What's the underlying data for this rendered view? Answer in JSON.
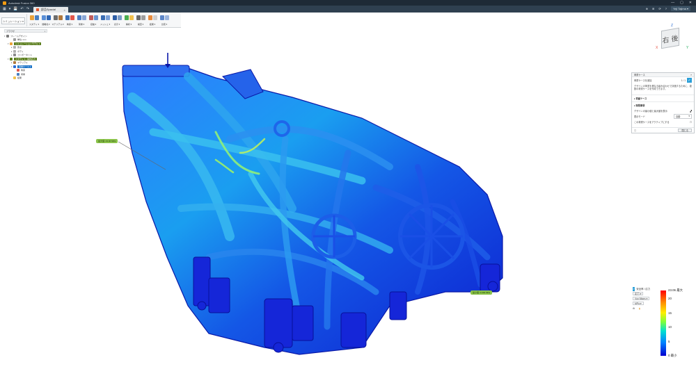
{
  "window": {
    "title": "Autodesk Fusion 360",
    "controls": [
      "—",
      "▢",
      "✕"
    ]
  },
  "tab": {
    "label": "部品Spacial",
    "close": "×"
  },
  "quick_access": [
    "▦",
    "▾",
    "💾",
    "↶",
    "↷"
  ],
  "top_right": {
    "user": "Yeji Tajima ▾",
    "icons": [
      "⊕",
      "⊞",
      "⟳",
      "?"
    ]
  },
  "ribbon": {
    "workspace": "シミュレーション ▾",
    "groups": [
      {
        "label": "スタディ ▾",
        "colors": [
          "#e9a23b",
          "#4a7fc1"
        ]
      },
      {
        "label": "簡略化 ▾",
        "colors": [
          "#5a8fd6",
          "#2d66b5"
        ]
      },
      {
        "label": "マテリアル ▾",
        "colors": [
          "#6d6d6d",
          "#b0773b"
        ]
      },
      {
        "label": "拘束 ▾",
        "colors": [
          "#3b6fb6",
          "#e2574c"
        ]
      },
      {
        "label": "荷重 ▾",
        "colors": [
          "#4f7fc4",
          "#8aa7d6"
        ]
      },
      {
        "label": "接触 ▾",
        "colors": [
          "#c05c5c",
          "#6a94cf"
        ]
      },
      {
        "label": "メッシュ ▾",
        "colors": [
          "#3a6db3",
          "#7aa0d8"
        ]
      },
      {
        "label": "表示 ▾",
        "colors": [
          "#2d5ea6",
          "#7a9bc6"
        ]
      },
      {
        "label": "解析 ▾",
        "colors": [
          "#4caf50",
          "#f2c14e"
        ]
      },
      {
        "label": "検査 ▾",
        "colors": [
          "#6b6b6b",
          "#9e9e9e"
        ]
      },
      {
        "label": "結果 ▾",
        "colors": [
          "#e88b3c",
          "#cfcfcf"
        ]
      },
      {
        "label": "比較 ▾",
        "colors": [
          "#5c86c8",
          "#9ab4dd"
        ]
      }
    ]
  },
  "browser": {
    "title": "ブラウザ",
    "nodes": [
      {
        "label": "フレームデザイン",
        "indent": 0,
        "twisty": "▾",
        "color": "#7a7a7a",
        "style": ""
      },
      {
        "label": "単位: mm",
        "indent": 2,
        "twisty": "",
        "color": "#9b9b9b",
        "style": ""
      },
      {
        "label": "シミュレーションモデル 1",
        "indent": 1,
        "twisty": "▾",
        "color": "#e9a23b",
        "style": "hl"
      },
      {
        "label": "原点",
        "indent": 2,
        "twisty": "▸",
        "color": "#b0b0b0",
        "style": ""
      },
      {
        "label": "ボディ",
        "indent": 2,
        "twisty": "▸",
        "color": "#b0b0b0",
        "style": ""
      },
      {
        "label": "コンポーネント",
        "indent": 2,
        "twisty": "▸",
        "color": "#8a8a8a",
        "style": ""
      },
      {
        "label": "スタディ 1 - 静的応力",
        "indent": 1,
        "twisty": "▾",
        "color": "#5b7e1d",
        "style": "hl"
      },
      {
        "label": "マテリアル",
        "indent": 2,
        "twisty": "▸",
        "color": "#b07a3b",
        "style": ""
      },
      {
        "label": "荷重ケース 1",
        "indent": 2,
        "twisty": "▾",
        "color": "#2a6dd4",
        "style": "sel"
      },
      {
        "label": "拘束",
        "indent": 3,
        "twisty": "",
        "color": "#e2574c",
        "style": ""
      },
      {
        "label": "荷重",
        "indent": 3,
        "twisty": "",
        "color": "#4a7fc1",
        "style": ""
      },
      {
        "label": "結果",
        "indent": 2,
        "twisty": "",
        "color": "#f2c14e",
        "style": ""
      }
    ]
  },
  "viewcube": {
    "face_left": "右",
    "face_right": "後",
    "x": "X",
    "y": "Y",
    "z": "Z"
  },
  "dialog": {
    "title": "荷重ケース",
    "row1_label": "荷重ケースを追加",
    "row1_value": "1 / 1",
    "check": "✓",
    "description": "デザインの荷重を異なる組み合わせで評価するために、複数の荷重ケースを作成できます。",
    "section1": "▸ 荷重ケース",
    "section2": "▸ 制限事項",
    "row2_label": "デザインの最小値と最大値を表示",
    "row3_label": "表示モード",
    "row3_value": "自動",
    "row4_label": "この荷重ケースをアクティブにする",
    "info": "ⓘ",
    "close_btn": "閉じる"
  },
  "probes": [
    {
      "label": "最大値: 23.06 MPa"
    },
    {
      "label": "最小値: 0.000 MPa"
    }
  ],
  "legend": {
    "check": "✓",
    "type_label": "安全率 / 応力",
    "mode_btn": "応力 ▾",
    "units_btn": "Von Mises ▾",
    "extra_btn": "MPa ▾",
    "icons": [
      "⚙",
      "▮"
    ],
    "ticks": [
      {
        "label": "23.06 最大",
        "value": 23.06
      },
      {
        "label": "20",
        "value": 20
      },
      {
        "label": "15",
        "value": 15
      },
      {
        "label": "10",
        "value": 10
      },
      {
        "label": "5",
        "value": 5
      },
      {
        "label": "0 最小",
        "value": 0
      }
    ],
    "max": 23.06,
    "min": 0
  }
}
